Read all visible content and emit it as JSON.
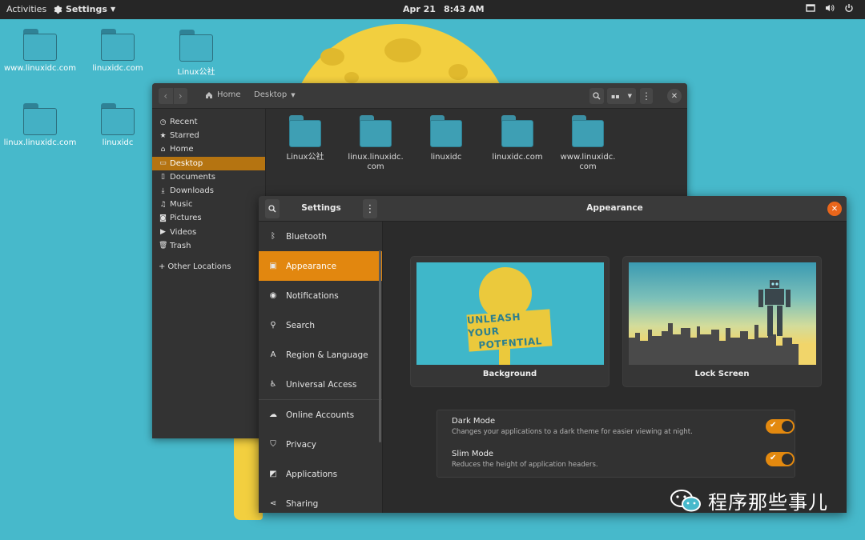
{
  "topbar": {
    "activities": "Activities",
    "app_menu": "Settings",
    "date": "Apr 21",
    "time": "8:43 AM",
    "tray_icons": [
      "screen-icon",
      "volume-icon",
      "power-icon"
    ]
  },
  "desktop": {
    "icons": [
      {
        "label": "www.linuxidc.com"
      },
      {
        "label": "linuxidc.com"
      },
      {
        "label": "Linux公社"
      },
      {
        "label": "linux.linuxidc.com"
      },
      {
        "label": "linuxidc"
      }
    ]
  },
  "files": {
    "nav_back": "‹",
    "nav_forward": "›",
    "breadcrumb_home": "Home",
    "breadcrumb_current": "Desktop",
    "sidebar": [
      {
        "label": "Recent",
        "icon": "clock-icon"
      },
      {
        "label": "Starred",
        "icon": "star-icon"
      },
      {
        "label": "Home",
        "icon": "home-icon"
      },
      {
        "label": "Desktop",
        "icon": "desktop-icon",
        "active": true
      },
      {
        "label": "Documents",
        "icon": "document-icon"
      },
      {
        "label": "Downloads",
        "icon": "download-icon"
      },
      {
        "label": "Music",
        "icon": "music-icon"
      },
      {
        "label": "Pictures",
        "icon": "camera-icon"
      },
      {
        "label": "Videos",
        "icon": "video-icon"
      },
      {
        "label": "Trash",
        "icon": "trash-icon"
      }
    ],
    "other_locations": "Other Locations",
    "items": [
      {
        "line1": "Linux公社",
        "line2": ""
      },
      {
        "line1": "linux.linuxidc.",
        "line2": "com"
      },
      {
        "line1": "linuxidc",
        "line2": ""
      },
      {
        "line1": "linuxidc.com",
        "line2": ""
      },
      {
        "line1": "www.linuxidc.",
        "line2": "com"
      }
    ]
  },
  "settings": {
    "title": "Settings",
    "page_title": "Appearance",
    "sidebar": [
      {
        "label": "Bluetooth",
        "icon": "bluetooth-icon"
      },
      {
        "label": "Appearance",
        "icon": "display-icon",
        "active": true
      },
      {
        "label": "Notifications",
        "icon": "notifications-icon"
      },
      {
        "label": "Search",
        "icon": "search-icon"
      },
      {
        "label": "Region & Language",
        "icon": "language-icon"
      },
      {
        "label": "Universal Access",
        "icon": "accessibility-icon"
      },
      {
        "label": "Online Accounts",
        "icon": "cloud-icon"
      },
      {
        "label": "Privacy",
        "icon": "privacy-icon"
      },
      {
        "label": "Applications",
        "icon": "applications-icon"
      },
      {
        "label": "Sharing",
        "icon": "share-icon"
      }
    ],
    "background_label": "Background",
    "lockscreen_label": "Lock Screen",
    "wallpaper_text": [
      "UNLEASH YOUR",
      "POTENTIAL"
    ],
    "dark_mode": {
      "title": "Dark Mode",
      "description": "Changes your applications to a dark theme for easier viewing at night.",
      "enabled": true
    },
    "slim_mode": {
      "title": "Slim Mode",
      "description": "Reduces the height of application headers.",
      "enabled": true
    }
  },
  "watermark": {
    "text": "程序那些事儿"
  },
  "colors": {
    "wallpaper": "#47b9cb",
    "accent": "#e2870f",
    "files_active": "#b57411",
    "close_button": "#e9661b",
    "folder": "#44b0c4"
  }
}
